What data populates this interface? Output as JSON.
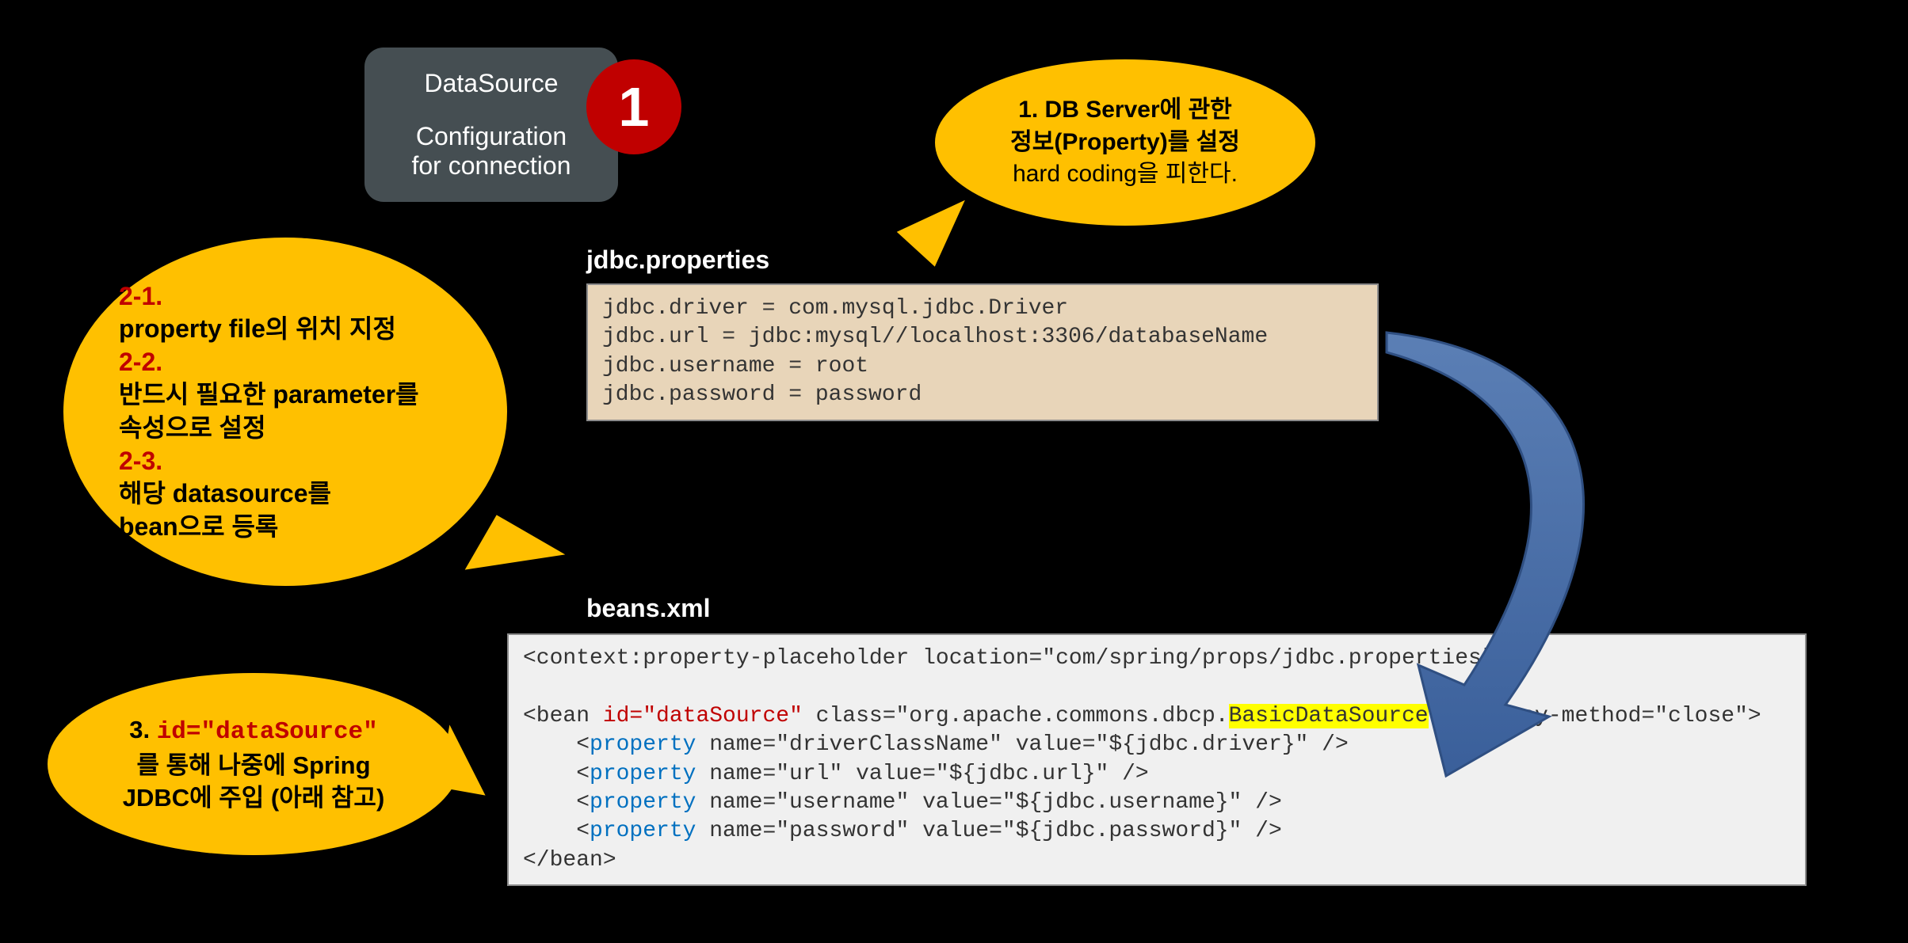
{
  "datasource_box": {
    "title": "DataSource",
    "subtitle": "Configuration\nfor connection"
  },
  "badge_1": "1",
  "bubble1": {
    "line1": "1. DB Server에 관한",
    "line2": "정보(Property)를 설정",
    "line3": "hard coding을 피한다."
  },
  "bubble2": {
    "h1": "2-1.",
    "l1": "property file의 위치 지정",
    "h2": "2-2.",
    "l2a": "반드시 필요한 parameter를",
    "l2b": "속성으로 설정",
    "h3": "2-3.",
    "l3a": "해당 datasource를",
    "l3b": "bean으로 등록"
  },
  "bubble3": {
    "line_pre": "3. ",
    "line_red": "id=\"dataSource\"",
    "line2": "를 통해 나중에 Spring",
    "line3": "JDBC에 주입 (아래 참고)"
  },
  "labels": {
    "jdbc": "jdbc.properties",
    "beans": "beans.xml"
  },
  "code_jdbc": "jdbc.driver = com.mysql.jdbc.Driver\njdbc.url = jdbc:mysql//localhost:3306/databaseName\njdbc.username = root\njdbc.password = password",
  "code_beans": {
    "l1": "<context:property-placeholder location=\"com/spring/props/jdbc.properties\"/>",
    "blank": "",
    "l2a": "<bean ",
    "l2_id": "id=\"dataSource\"",
    "l2b": " class=\"org.apache.commons.dbcp.",
    "l2_hl": "BasicDataSource",
    "l2c": "\" destroy-method=\"close\">",
    "l3a": "    <",
    "prop": "property",
    "l3b": " name=\"driverClassName\" value=\"${jdbc.driver}\" />",
    "l4b": " name=\"url\" value=\"${jdbc.url}\" />",
    "l5b": " name=\"username\" value=\"${jdbc.username}\" />",
    "l6b": " name=\"password\" value=\"${jdbc.password}\" />",
    "l7": "</bean>"
  }
}
